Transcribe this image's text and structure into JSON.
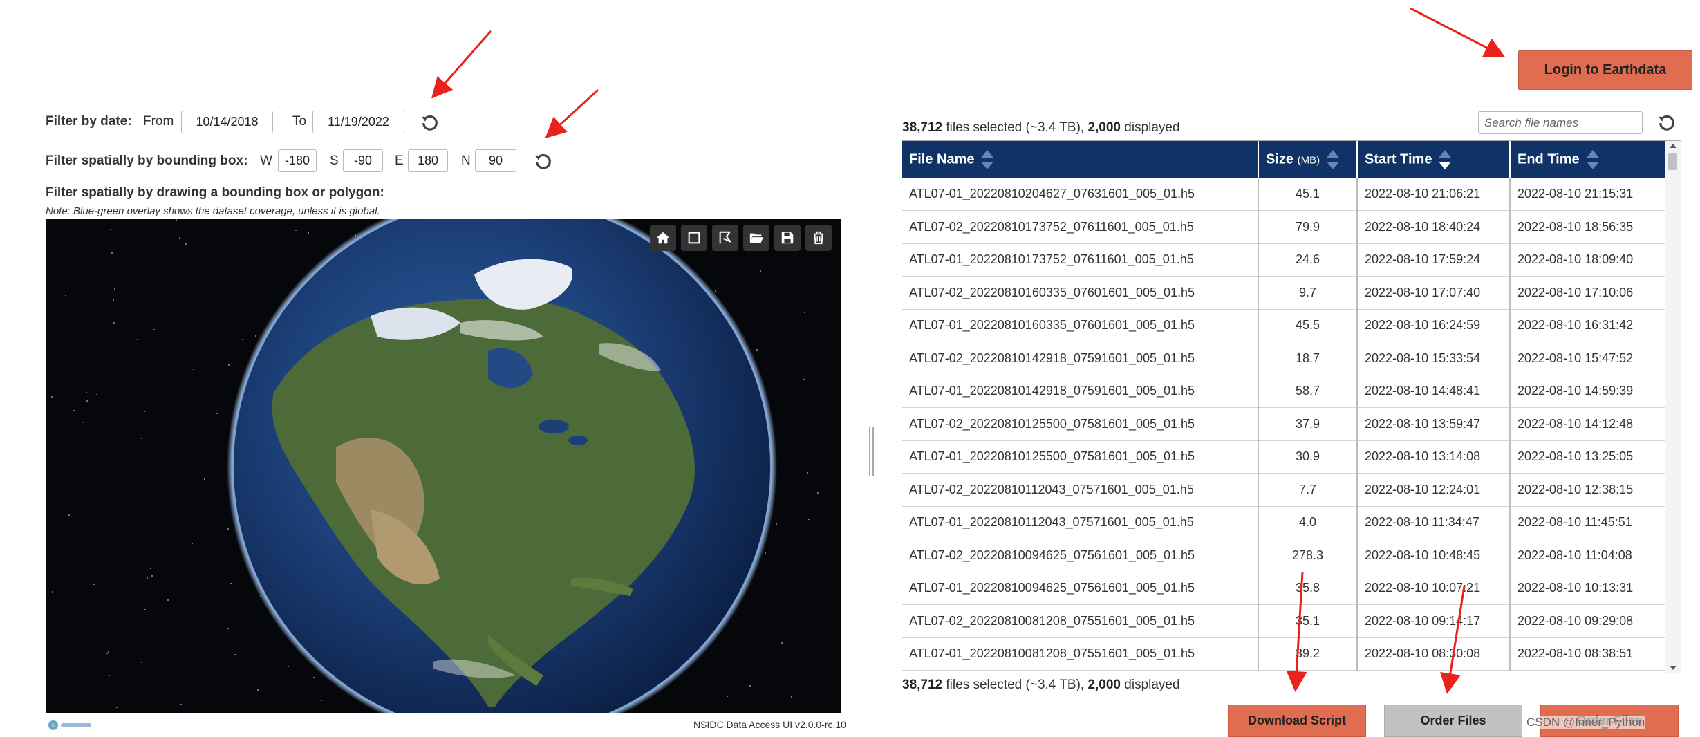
{
  "filters": {
    "date": {
      "label": "Filter by date:",
      "from_label": "From",
      "from_value": "10/14/2018",
      "to_label": "To",
      "to_value": "11/19/2022"
    },
    "bbox": {
      "label": "Filter spatially by bounding box:",
      "w_label": "W",
      "w_value": "-180",
      "s_label": "S",
      "s_value": "-90",
      "e_label": "E",
      "e_value": "180",
      "n_label": "N",
      "n_value": "90"
    },
    "polygon": {
      "label": "Filter spatially by drawing a bounding box or polygon:",
      "note": "Note: Blue-green overlay shows the dataset coverage, unless it is global."
    }
  },
  "map": {
    "toolbar": [
      "home-icon",
      "rectangle-icon",
      "polygon-icon",
      "open-folder-icon",
      "save-icon",
      "trash-icon"
    ],
    "version": "NSIDC Data Access UI v2.0.0-rc.10"
  },
  "header": {
    "login_label": "Login to Earthdata"
  },
  "results": {
    "count": "38,712",
    "selected_text": " files selected (~3.4 TB), ",
    "displayed_count": "2,000",
    "displayed_text": " displayed",
    "search_placeholder": "Search file names",
    "columns": {
      "file_name": "File Name",
      "size": "Size",
      "size_unit": "(MB)",
      "start_time": "Start Time",
      "end_time": "End Time"
    },
    "rows": [
      {
        "file": "ATL07-01_20220810204627_07631601_005_01.h5",
        "size": "45.1",
        "start": "2022-08-10 21:06:21",
        "end": "2022-08-10 21:15:31"
      },
      {
        "file": "ATL07-02_20220810173752_07611601_005_01.h5",
        "size": "79.9",
        "start": "2022-08-10 18:40:24",
        "end": "2022-08-10 18:56:35"
      },
      {
        "file": "ATL07-01_20220810173752_07611601_005_01.h5",
        "size": "24.6",
        "start": "2022-08-10 17:59:24",
        "end": "2022-08-10 18:09:40"
      },
      {
        "file": "ATL07-02_20220810160335_07601601_005_01.h5",
        "size": "9.7",
        "start": "2022-08-10 17:07:40",
        "end": "2022-08-10 17:10:06"
      },
      {
        "file": "ATL07-01_20220810160335_07601601_005_01.h5",
        "size": "45.5",
        "start": "2022-08-10 16:24:59",
        "end": "2022-08-10 16:31:42"
      },
      {
        "file": "ATL07-02_20220810142918_07591601_005_01.h5",
        "size": "18.7",
        "start": "2022-08-10 15:33:54",
        "end": "2022-08-10 15:47:52"
      },
      {
        "file": "ATL07-01_20220810142918_07591601_005_01.h5",
        "size": "58.7",
        "start": "2022-08-10 14:48:41",
        "end": "2022-08-10 14:59:39"
      },
      {
        "file": "ATL07-02_20220810125500_07581601_005_01.h5",
        "size": "37.9",
        "start": "2022-08-10 13:59:47",
        "end": "2022-08-10 14:12:48"
      },
      {
        "file": "ATL07-01_20220810125500_07581601_005_01.h5",
        "size": "30.9",
        "start": "2022-08-10 13:14:08",
        "end": "2022-08-10 13:25:05"
      },
      {
        "file": "ATL07-02_20220810112043_07571601_005_01.h5",
        "size": "7.7",
        "start": "2022-08-10 12:24:01",
        "end": "2022-08-10 12:38:15"
      },
      {
        "file": "ATL07-01_20220810112043_07571601_005_01.h5",
        "size": "4.0",
        "start": "2022-08-10 11:34:47",
        "end": "2022-08-10 11:45:51"
      },
      {
        "file": "ATL07-02_20220810094625_07561601_005_01.h5",
        "size": "278.3",
        "start": "2022-08-10 10:48:45",
        "end": "2022-08-10 11:04:08"
      },
      {
        "file": "ATL07-01_20220810094625_07561601_005_01.h5",
        "size": "35.8",
        "start": "2022-08-10 10:07:21",
        "end": "2022-08-10 10:13:31"
      },
      {
        "file": "ATL07-02_20220810081208_07551601_005_01.h5",
        "size": "35.1",
        "start": "2022-08-10 09:14:17",
        "end": "2022-08-10 09:29:08"
      },
      {
        "file": "ATL07-01_20220810081208_07551601_005_01.h5",
        "size": "39.2",
        "start": "2022-08-10 08:30:08",
        "end": "2022-08-10 08:38:51"
      }
    ]
  },
  "footer": {
    "download_label": "Download Script",
    "order_label": "Order Files",
    "third_label": "Order Files",
    "watermark": "CSDN @Inner_Python"
  },
  "colors": {
    "accent": "#e06d4f",
    "table_header": "#0f3366",
    "disabled": "#c2c2c2",
    "annotation_arrow": "#e8231d"
  }
}
